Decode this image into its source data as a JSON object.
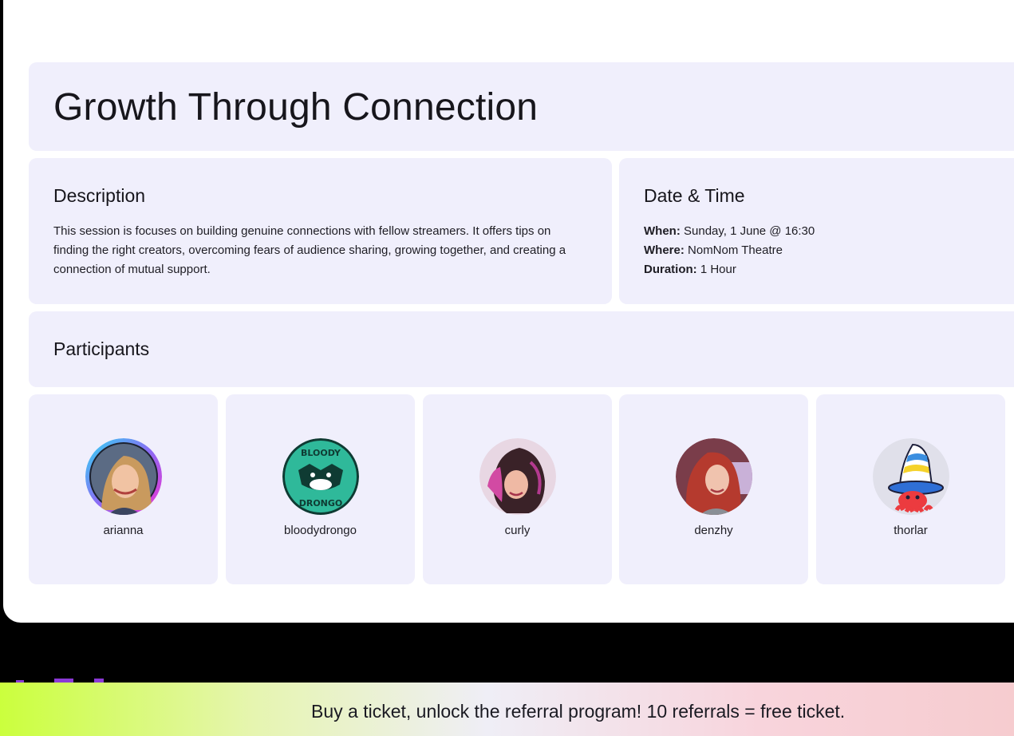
{
  "session": {
    "title": "Growth Through Connection"
  },
  "description": {
    "heading": "Description",
    "text": "This session is focuses on building genuine connections with fellow streamers. It offers tips on finding the right creators, overcoming fears of audience sharing, growing together, and creating a connection of mutual support."
  },
  "datetime": {
    "heading": "Date & Time",
    "when_label": "When:",
    "when_value": "Sunday, 1 June @ 16:30",
    "where_label": "Where:",
    "where_value": "NomNom Theatre",
    "duration_label": "Duration:",
    "duration_value": "1 Hour"
  },
  "participants": {
    "heading": "Participants",
    "items": [
      {
        "name": "arianna"
      },
      {
        "name": "bloodydrongo",
        "avatar_text_top": "BLOODY",
        "avatar_text_bottom": "DRONGO"
      },
      {
        "name": "curly"
      },
      {
        "name": "denzhy"
      },
      {
        "name": "thorlar"
      }
    ]
  },
  "promo": {
    "text": "Buy a ticket, unlock the referral program! 10 referrals = free ticket."
  },
  "colors": {
    "panel_bg": "#f0effc",
    "page_bg": "#000000",
    "card_bg": "#ffffff",
    "promo_gradient_start": "#cbff3d",
    "promo_gradient_end": "#f6cccf"
  }
}
